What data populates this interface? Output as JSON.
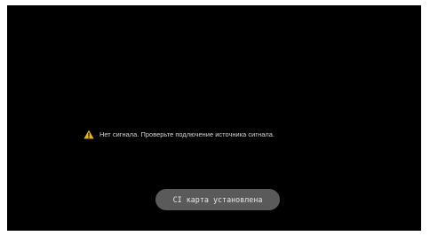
{
  "status": {
    "icon": "warning-triangle-icon",
    "icon_color": "#e6b800",
    "message": "Нет сигнала. Проверьте подлючение источника сигнала."
  },
  "notification": {
    "text": "CI карта установлена"
  }
}
